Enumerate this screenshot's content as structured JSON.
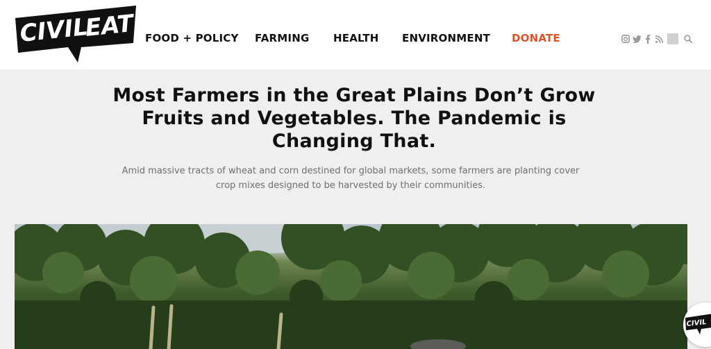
{
  "brand": {
    "name": "Civil Eats",
    "logo_text_left": "CIVIL",
    "logo_text_right": "EATS"
  },
  "nav": {
    "items": [
      {
        "label": "FOOD + POLICY"
      },
      {
        "label": "FARMING"
      },
      {
        "label": "HEALTH"
      },
      {
        "label": "ENVIRONMENT"
      },
      {
        "label": "DONATE"
      }
    ]
  },
  "social": {
    "icons": [
      "instagram-icon",
      "twitter-icon",
      "facebook-icon",
      "rss-icon",
      "search-icon"
    ]
  },
  "article": {
    "title": "Most Farmers in the Great Plains Don’t Grow Fruits and Vegetables. The Pandemic is Changing That.",
    "subtitle": "Amid massive tracts of wheat and corn destined for global markets, some farmers are planting cover crop mixes designed to be harvested by their communities."
  },
  "colors": {
    "accent": "#e0522a",
    "background": "#efefef",
    "header": "#ffffff",
    "text": "#111111",
    "muted": "#6e6e6e"
  }
}
